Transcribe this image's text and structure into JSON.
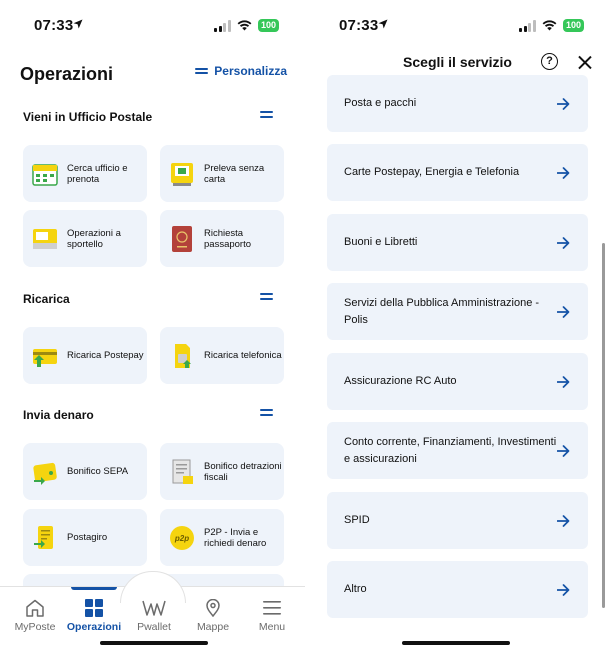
{
  "status_left": {
    "time": "07:33",
    "battery": "100"
  },
  "status_right": {
    "time": "07:33",
    "battery": "100"
  },
  "operazioni": {
    "title": "Operazioni",
    "personalizza": "Personalizza",
    "sections": [
      {
        "title": "Vieni in Ufficio Postale",
        "tiles": [
          {
            "label": "Cerca ufficio e prenota",
            "icon": "calendar-icon"
          },
          {
            "label": "Preleva senza carta",
            "icon": "atm-icon"
          },
          {
            "label": "Operazioni a sportello",
            "icon": "counter-icon"
          },
          {
            "label": "Richiesta passaporto",
            "icon": "passport-icon"
          }
        ]
      },
      {
        "title": "Ricarica",
        "tiles": [
          {
            "label": "Ricarica Postepay",
            "icon": "card-topup-icon"
          },
          {
            "label": "Ricarica telefonica",
            "icon": "sim-icon"
          }
        ]
      },
      {
        "title": "Invia denaro",
        "tiles": [
          {
            "label": "Bonifico SEPA",
            "icon": "wallet-icon"
          },
          {
            "label": "Bonifico detrazioni fiscali",
            "icon": "receipt-icon"
          },
          {
            "label": "Postagiro",
            "icon": "postagiro-icon"
          },
          {
            "label": "P2P - Invia e richiedi denaro",
            "icon": "p2p-icon"
          }
        ]
      }
    ]
  },
  "tabbar": {
    "tabs": [
      {
        "label": "MyPoste",
        "icon": "home-icon",
        "active": false
      },
      {
        "label": "Operazioni",
        "icon": "grid-icon",
        "active": true
      },
      {
        "label": "Pwallet",
        "icon": "wallet-logo-icon",
        "active": false
      },
      {
        "label": "Mappe",
        "icon": "map-pin-icon",
        "active": false
      },
      {
        "label": "Menu",
        "icon": "menu-icon",
        "active": false
      }
    ]
  },
  "servizio": {
    "title": "Scegli il servizio",
    "help": "?",
    "items": [
      "Posta e pacchi",
      "Carte Postepay, Energia e Telefonia",
      "Buoni e Libretti",
      "Servizi della Pubblica Amministrazione - Polis",
      "Assicurazione RC Auto",
      "Conto corrente, Finanziamenti, Investimenti e assicurazioni",
      "SPID",
      "Altro"
    ]
  },
  "colors": {
    "accent": "#1452a6",
    "tile_bg": "#eef3fa",
    "icon_yellow": "#f5d40f",
    "icon_green": "#3aa84a",
    "battery": "#35c759"
  }
}
